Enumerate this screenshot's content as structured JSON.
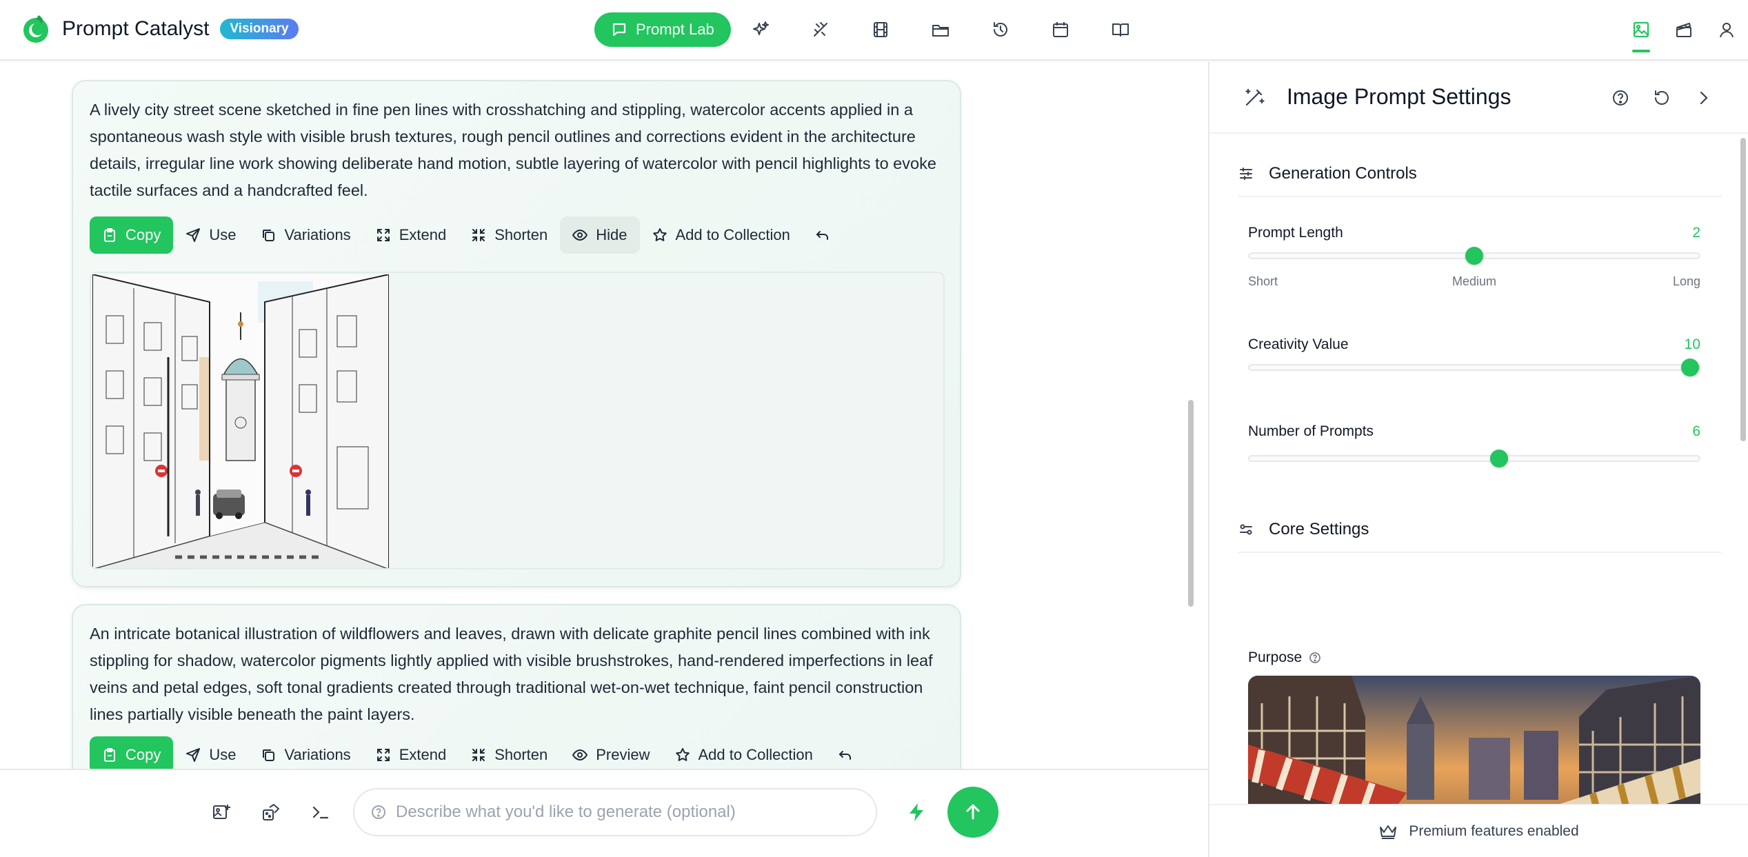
{
  "app": {
    "name": "Prompt Catalyst",
    "badge": "Visionary"
  },
  "nav": {
    "primary_label": "Prompt Lab",
    "icons": [
      "sparkles-icon",
      "wand-tools-icon",
      "film-icon",
      "folder-icon",
      "history-icon",
      "calendar-icon",
      "book-icon"
    ]
  },
  "top_right": {
    "icons": [
      "image-icon",
      "clapperboard-icon",
      "user-icon"
    ],
    "active": "image-icon"
  },
  "cards": [
    {
      "text": "A lively city street scene sketched in fine pen lines with crosshatching and stippling, watercolor accents applied in a spontaneous wash style with visible brush textures, rough pencil outlines and corrections evident in the architecture details, irregular line work showing deliberate hand motion, subtle layering of watercolor with pencil highlights to evoke tactile surfaces and a handcrafted feel.",
      "actions": {
        "copy": "Copy",
        "use": "Use",
        "variations": "Variations",
        "extend": "Extend",
        "shorten": "Shorten",
        "toggle": "Hide",
        "collection": "Add to Collection"
      }
    },
    {
      "text": "An intricate botanical illustration of wildflowers and leaves, drawn with delicate graphite pencil lines combined with ink stippling for shadow, watercolor pigments lightly applied with visible brushstrokes, hand-rendered imperfections in leaf veins and petal edges, soft tonal gradients created through traditional wet-on-wet technique, faint pencil construction lines partially visible beneath the paint layers.",
      "actions": {
        "copy": "Copy",
        "use": "Use",
        "variations": "Variations",
        "extend": "Extend",
        "shorten": "Shorten",
        "toggle": "Preview",
        "collection": "Add to Collection"
      }
    }
  ],
  "input": {
    "placeholder": "Describe what you'd like to generate (optional)",
    "value": ""
  },
  "panel": {
    "title": "Image Prompt Settings",
    "generation_controls": {
      "title": "Generation Controls",
      "prompt_length": {
        "label": "Prompt Length",
        "value": "2",
        "fraction": 0.5,
        "ticks": [
          "Short",
          "Medium",
          "Long"
        ]
      },
      "creativity": {
        "label": "Creativity Value",
        "value": "10",
        "fraction": 0.98
      },
      "num_prompts": {
        "label": "Number of Prompts",
        "value": "6",
        "fraction": 0.555
      }
    },
    "core_settings": {
      "title": "Core Settings",
      "purpose_label": "Purpose"
    },
    "footer": "Premium features enabled"
  },
  "colors": {
    "accent": "#22c55e",
    "badge_from": "#22b8cf",
    "badge_to": "#5b7cf0",
    "card_bg": "#eef7f3"
  }
}
